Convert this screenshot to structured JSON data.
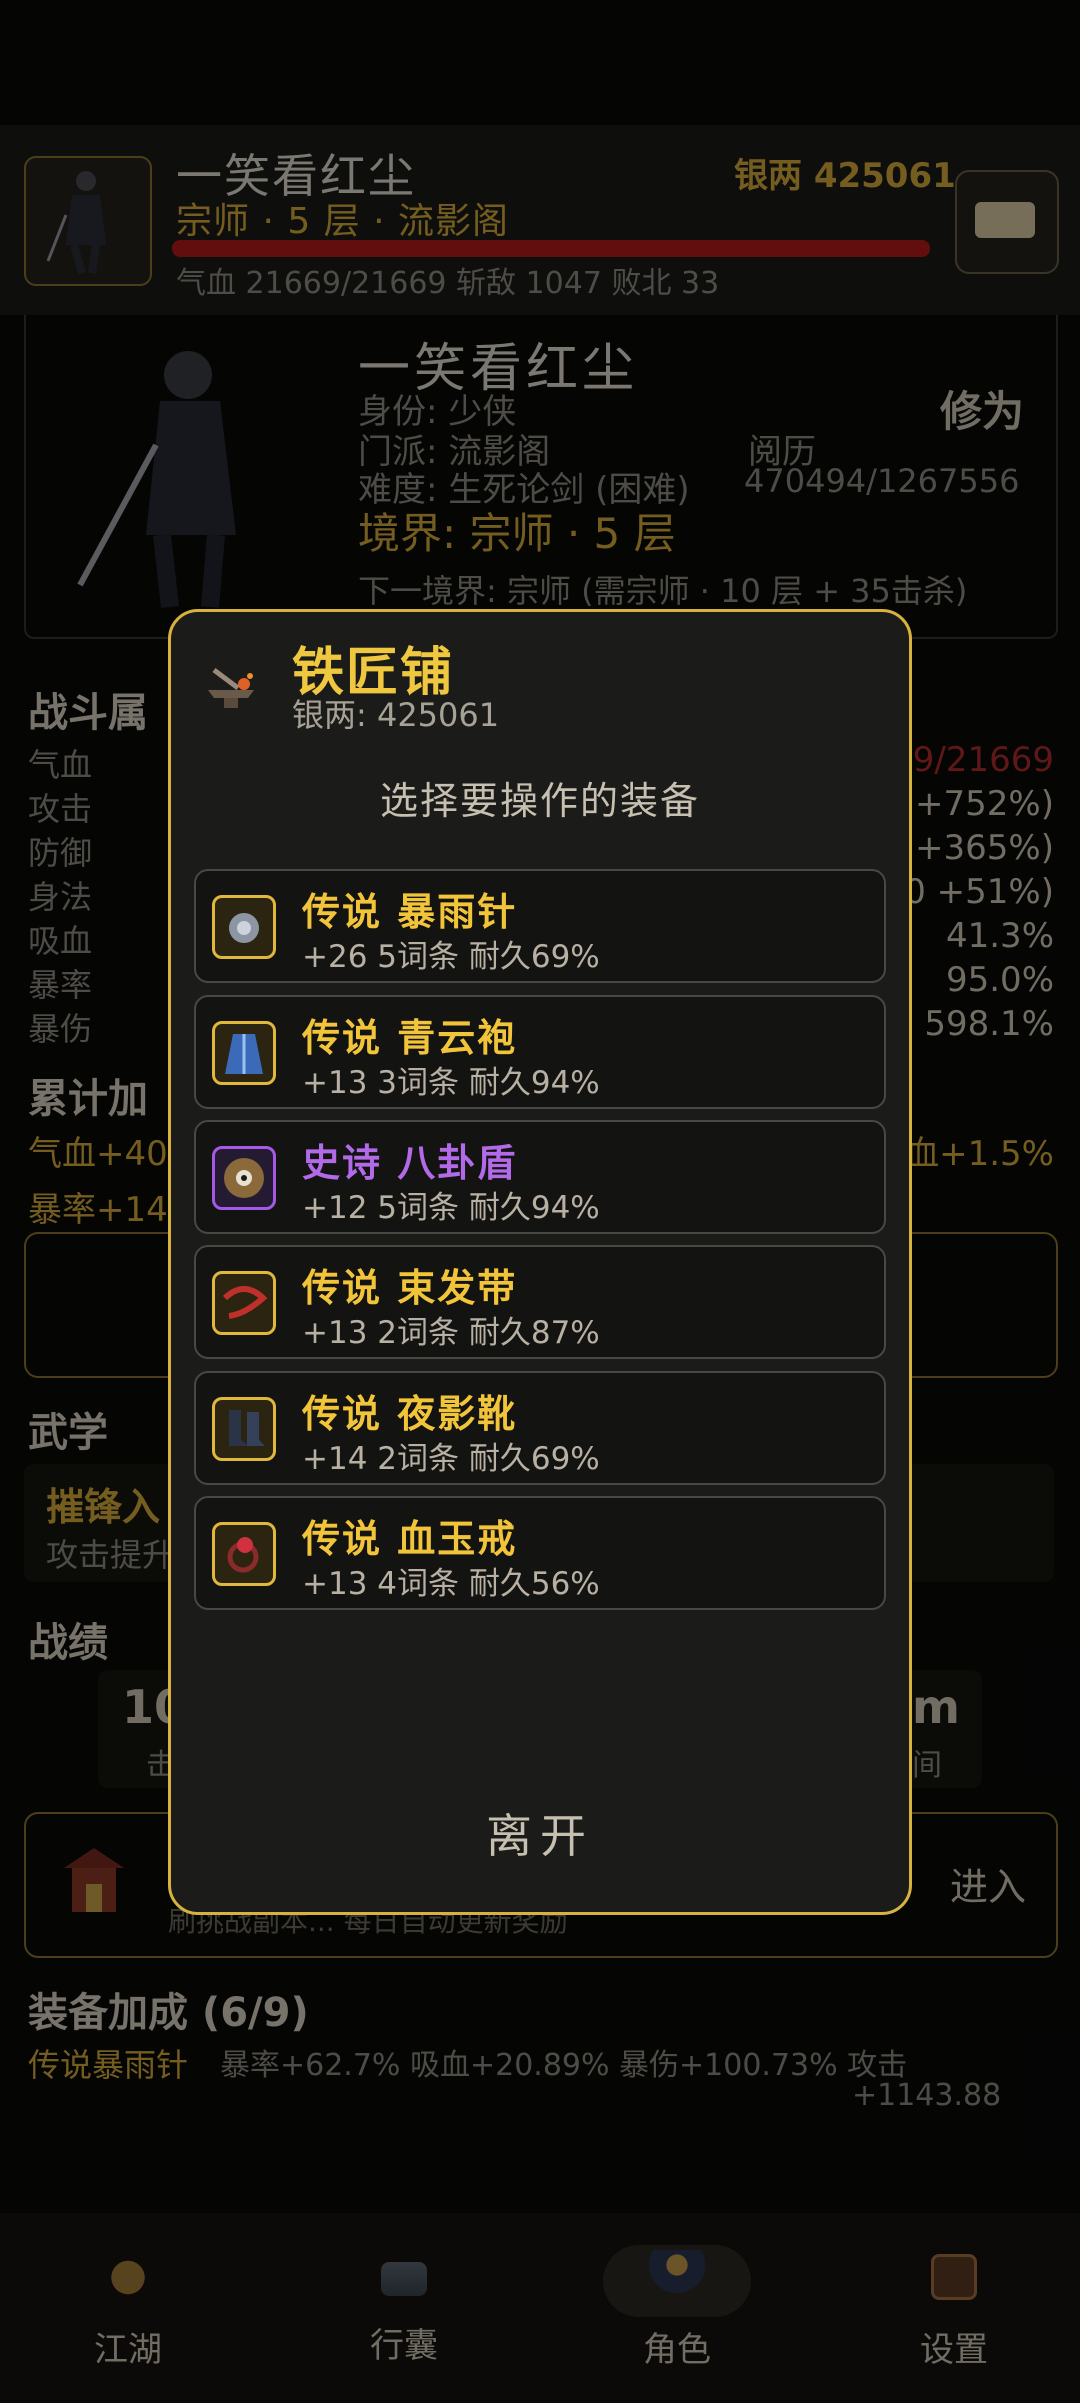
{
  "header": {
    "name": "一笑看红尘",
    "silver": "银两 425061",
    "rank": "宗师 · 5 层 · 流影阁",
    "stats": "气血 21669/21669   斩敌 1047   败北 33"
  },
  "profile": {
    "name": "一笑看红尘",
    "identity": "身份: 少侠",
    "sect": "门派: 流影阁",
    "difficulty": "难度: 生死论剑 (困难)",
    "realm": "境界: 宗师 · 5 层",
    "next_realm": "下一境界: 宗师 (需宗师 · 10 层 + 35击杀)",
    "xiuwei_label": "修为",
    "yueli_label": "阅历",
    "exp": "470494/1267556"
  },
  "battle_attrs": {
    "title": "战斗属",
    "rows": [
      {
        "label": "气血",
        "value": "69/21669"
      },
      {
        "label": "攻击",
        "value": "+752%)"
      },
      {
        "label": "防御",
        "value": "+365%)"
      },
      {
        "label": "身法",
        "value": "0 +51%)"
      },
      {
        "label": "吸血",
        "value": "41.3%"
      },
      {
        "label": "暴率",
        "value": "95.0%"
      },
      {
        "label": "暴伤",
        "value": "598.1%"
      }
    ]
  },
  "cumulative": {
    "title": "累计加",
    "line1_left": "气血+40",
    "line1_right": "血+1.5%",
    "line2_left": "暴率+14"
  },
  "martial": {
    "title": "武学",
    "skill_name": "摧锋入",
    "skill_desc": "攻击提升"
  },
  "record": {
    "title": "战绩",
    "left_value": "10",
    "left_label": "击",
    "right_value": "m",
    "right_label": "间"
  },
  "enter_section": {
    "button": "进入",
    "desc": "刷挑战副本... 每日自动更新奖励"
  },
  "equip_bonus": {
    "title": "装备加成 (6/9)",
    "item_name": "传说暴雨针",
    "line1": "暴率+62.7% 吸血+20.89% 暴伤+100.73% 攻击",
    "line2": "+1143.88"
  },
  "nav": [
    {
      "label": "江湖",
      "icon": "jianghu-icon"
    },
    {
      "label": "行囊",
      "icon": "bag-icon"
    },
    {
      "label": "角色",
      "icon": "character-icon"
    },
    {
      "label": "设置",
      "icon": "settings-icon"
    }
  ],
  "modal": {
    "title": "铁匠铺",
    "silver": "银两: 425061",
    "prompt": "选择要操作的装备",
    "leave": "离开",
    "items": [
      {
        "name": "传说 暴雨针",
        "detail": "+26  5词条  耐久69%",
        "rarity": "legendary",
        "icon": "needle-icon"
      },
      {
        "name": "传说 青云袍",
        "detail": "+13  3词条  耐久94%",
        "rarity": "legendary",
        "icon": "robe-icon"
      },
      {
        "name": "史诗 八卦盾",
        "detail": "+12  5词条  耐久94%",
        "rarity": "epic",
        "icon": "shield-icon"
      },
      {
        "name": "传说 束发带",
        "detail": "+13  2词条  耐久87%",
        "rarity": "legendary",
        "icon": "headband-icon"
      },
      {
        "name": "传说 夜影靴",
        "detail": "+14  2词条  耐久69%",
        "rarity": "legendary",
        "icon": "boots-icon"
      },
      {
        "name": "传说 血玉戒",
        "detail": "+13  4词条  耐久56%",
        "rarity": "legendary",
        "icon": "ring-icon"
      }
    ]
  },
  "colors": {
    "gold": "#d4aa3a",
    "legendary": "#f2c43a",
    "epic": "#b36ae8",
    "hp_bar": "#b31a1a"
  }
}
